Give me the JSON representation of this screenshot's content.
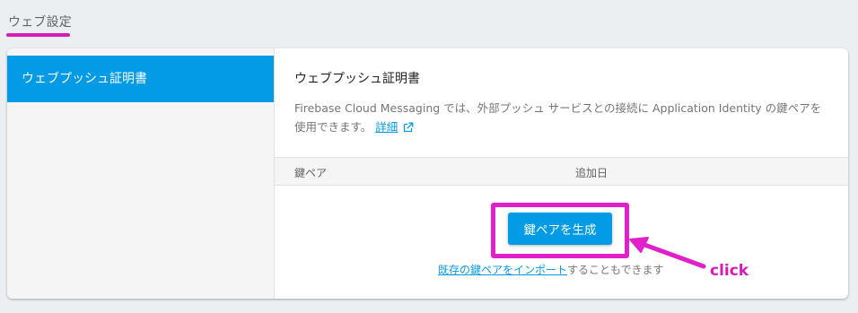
{
  "page": {
    "tab_title": "ウェブ設定"
  },
  "sidebar": {
    "items": [
      {
        "label": "ウェブプッシュ証明書",
        "active": true
      }
    ]
  },
  "content": {
    "title": "ウェブプッシュ証明書",
    "description": "Firebase Cloud Messaging では、外部プッシュ サービスとの接続に Application Identity の鍵ペアを使用できます。",
    "details_link": "詳細",
    "external_icon": "open-in-new-icon",
    "table": {
      "columns": [
        "鍵ペア",
        "追加日"
      ]
    },
    "generate_button": "鍵ペアを生成",
    "import_link": "既存の鍵ペアをインポート",
    "import_suffix": "することもできます"
  },
  "annotation": {
    "label": "click",
    "color": "#d81bb8"
  },
  "colors": {
    "accent": "#039be5",
    "highlight": "#e020c8"
  }
}
